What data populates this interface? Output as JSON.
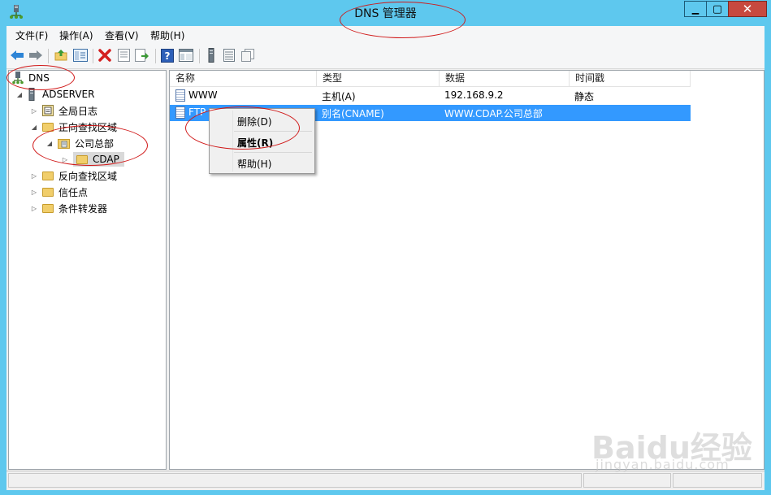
{
  "window": {
    "title": "DNS 管理器",
    "min_glyph": "▁",
    "max_glyph": "▢",
    "close_glyph": "✕"
  },
  "menu": {
    "items": [
      "文件(F)",
      "操作(A)",
      "查看(V)",
      "帮助(H)"
    ]
  },
  "toolbar": {
    "icons": [
      "back-arrow-icon",
      "forward-arrow-icon",
      "up-folder-icon",
      "show-hide-tree-icon",
      "delete-icon",
      "properties-icon",
      "export-list-icon",
      "help-icon",
      "console-view-icon",
      "server-icon",
      "records-icon",
      "copy-icon"
    ]
  },
  "tree": {
    "root": "DNS",
    "server": "ADSERVER",
    "items": {
      "global_log": "全局日志",
      "forward_zones": "正向查找区域",
      "zone_company": "公司总部",
      "zone_cdap": "CDAP",
      "reverse_zones": "反向查找区域",
      "trust_points": "信任点",
      "conditional_forwarders": "条件转发器"
    }
  },
  "list": {
    "columns": [
      "名称",
      "类型",
      "数据",
      "时间戳"
    ],
    "rows": [
      {
        "name": "WWW",
        "type": "主机(A)",
        "data": "192.168.9.2",
        "timestamp": "静态"
      },
      {
        "name": "FTP",
        "type": "别名(CNAME)",
        "data": "WWW.CDAP.公司总部",
        "timestamp": ""
      }
    ],
    "selected_row": 1
  },
  "context_menu": {
    "items": [
      "删除(D)",
      "属性(R)",
      "帮助(H)"
    ]
  },
  "watermark": {
    "logo": "Baidu经验",
    "url": "jingyan.baidu.com"
  },
  "colors": {
    "titlebar": "#5ec8ee",
    "selection": "#3399ff",
    "annotation": "#d01818",
    "close_button": "#c7493f"
  }
}
